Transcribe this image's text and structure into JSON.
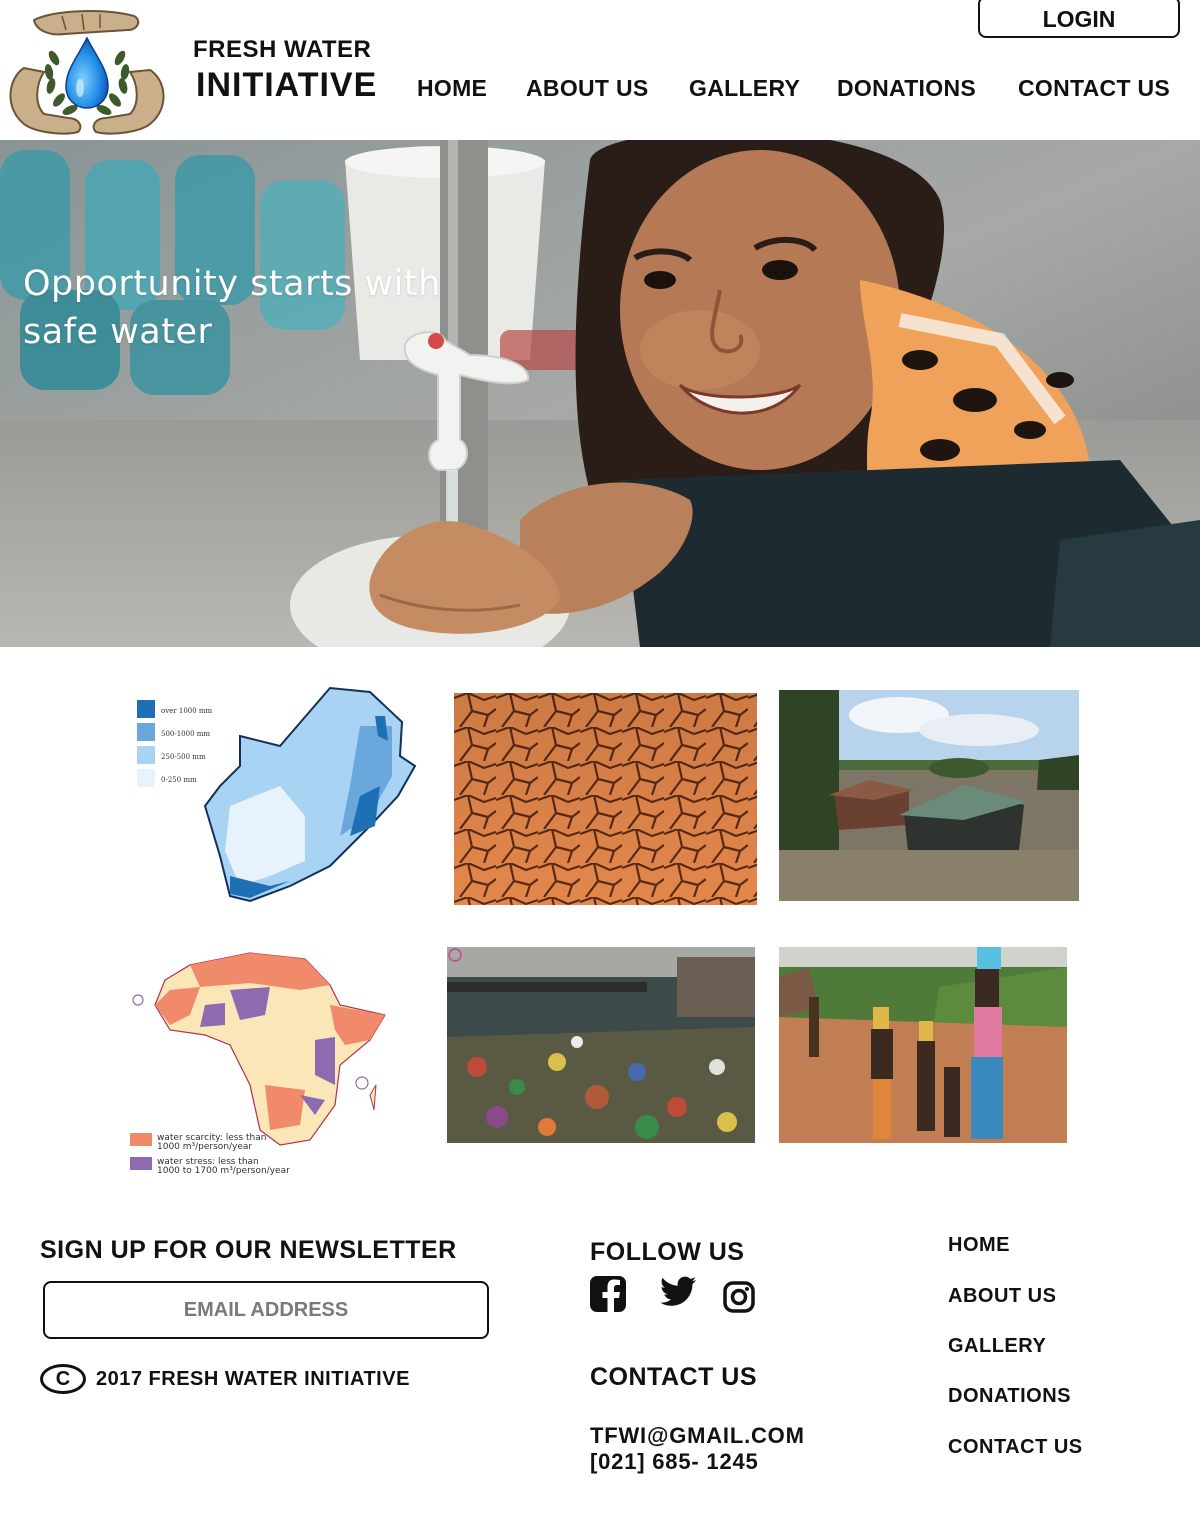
{
  "brand": {
    "line1": "FRESH WATER",
    "line2": "INITIATIVE",
    "logo_icon": "water-drop-laurel-hands-icon"
  },
  "header": {
    "login_label": "LOGIN",
    "nav": [
      "HOME",
      "ABOUT US",
      "GALLERY",
      "DONATIONS",
      "CONTACT US"
    ]
  },
  "hero": {
    "headline": "Opportunity starts with safe water"
  },
  "gallery": {
    "sa_map_legend": [
      "over 1000 mm",
      "500-1000 mm",
      "250-500 mm",
      "0-250 mm"
    ],
    "africa_legend": [
      {
        "line1": "water scarcity: less than",
        "line2": "1000 m³/person/year",
        "color": "#f08a6a"
      },
      {
        "line1": "water stress: less than",
        "line2": "1000 to 1700 m³/person/year",
        "color": "#8c6bb0"
      }
    ]
  },
  "footer": {
    "newsletter_heading": "SIGN UP FOR OUR NEWSLETTER",
    "email_placeholder": "EMAIL ADDRESS",
    "copyright": "2017 FRESH WATER INITIATIVE",
    "follow_heading": "FOLLOW US",
    "social_icons": [
      "facebook-icon",
      "twitter-icon",
      "instagram-icon"
    ],
    "contact_heading": "CONTACT US",
    "email": "TFWI@GMAIL.COM",
    "phone": "[021] 685- 1245",
    "nav": [
      "HOME",
      "ABOUT US",
      "GALLERY",
      "DONATIONS",
      "CONTACT US"
    ]
  },
  "colors": {
    "text": "#111111",
    "placeholder": "#7a7a7a",
    "water_blue": "#1e88e5"
  }
}
